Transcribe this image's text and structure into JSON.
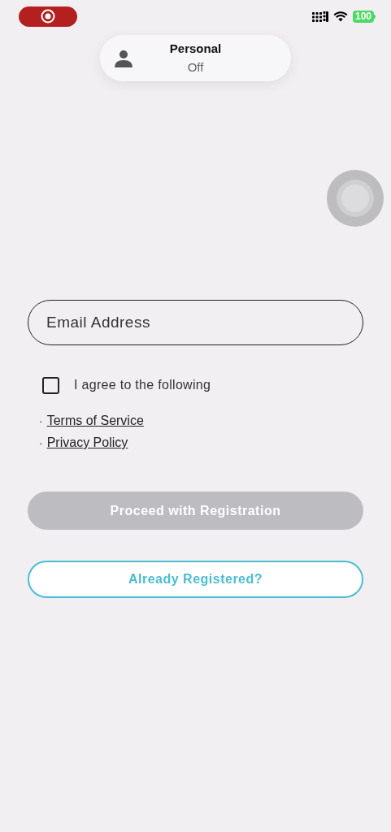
{
  "status_bar": {
    "battery": "100"
  },
  "focus_banner": {
    "title": "Personal",
    "state": "Off"
  },
  "form": {
    "email": {
      "placeholder": "Email Address"
    },
    "agree": {
      "label": "I agree to the following",
      "checked": false
    },
    "links": [
      {
        "bullet": "·",
        "label": "Terms of Service"
      },
      {
        "bullet": "·",
        "label": "Privacy Policy"
      }
    ],
    "proceed": {
      "label": "Proceed with Registration",
      "disabled": true
    },
    "already": {
      "label": "Already Registered?"
    }
  }
}
